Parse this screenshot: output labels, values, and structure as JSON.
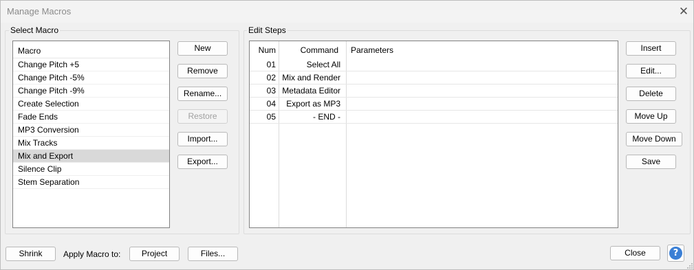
{
  "window": {
    "title": "Manage Macros",
    "close_glyph": "✕"
  },
  "select_macro": {
    "group_label": "Select Macro",
    "header": "Macro",
    "items": [
      "Change Pitch +5",
      "Change Pitch -5%",
      "Change Pitch -9%",
      "Create Selection",
      "Fade Ends",
      "MP3 Conversion",
      "Mix Tracks",
      "Mix and Export",
      "Silence Clip",
      "Stem Separation"
    ],
    "selected_index": 7,
    "buttons": {
      "new": "New",
      "remove": "Remove",
      "rename": "Rename...",
      "restore": "Restore",
      "import": "Import...",
      "export": "Export..."
    }
  },
  "edit_steps": {
    "group_label": "Edit Steps",
    "columns": {
      "num": "Num",
      "command": "Command",
      "parameters": "Parameters"
    },
    "rows": [
      {
        "num": "01",
        "command": "Select All",
        "parameters": ""
      },
      {
        "num": "02",
        "command": "Mix and Render",
        "parameters": ""
      },
      {
        "num": "03",
        "command": "Metadata Editor",
        "parameters": ""
      },
      {
        "num": "04",
        "command": "Export as MP3",
        "parameters": ""
      },
      {
        "num": "05",
        "command": "- END -",
        "parameters": ""
      }
    ],
    "buttons": {
      "insert": "Insert",
      "edit": "Edit...",
      "delete": "Delete",
      "move_up": "Move Up",
      "move_down": "Move Down",
      "save": "Save"
    }
  },
  "footer": {
    "shrink": "Shrink",
    "apply_label": "Apply Macro to:",
    "project": "Project",
    "files": "Files...",
    "close": "Close",
    "help_glyph": "?"
  },
  "colors": {
    "accent": "#3a7fd5",
    "selection": "#d9d9d9"
  }
}
